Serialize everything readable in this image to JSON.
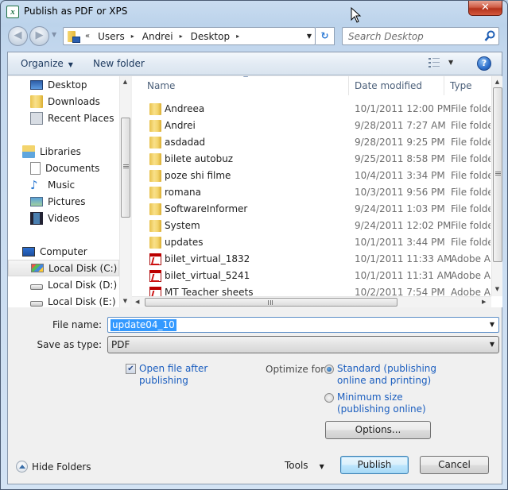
{
  "window": {
    "title": "Publish as PDF or XPS",
    "close_label": "✕"
  },
  "nav": {
    "back_label": "◀",
    "forward_label": "▶",
    "breadcrumb_prefix": "«",
    "breadcrumbs": [
      "Users",
      "Andrei",
      "Desktop"
    ],
    "crumb_arrow": "▸",
    "dropdown_arrow": "▼",
    "refresh_label": "↻",
    "search_placeholder": "Search Desktop"
  },
  "toolbar": {
    "organize_label": "Organize",
    "dropdown_arrow": "▼",
    "new_folder_label": "New folder",
    "help_label": "?"
  },
  "sidebar": {
    "items": [
      {
        "label": "Desktop",
        "icon": "desktop-icon",
        "level": 1
      },
      {
        "label": "Downloads",
        "icon": "downloads-icon",
        "level": 1
      },
      {
        "label": "Recent Places",
        "icon": "recent-places-icon",
        "level": 1
      },
      {
        "label": "Libraries",
        "icon": "libraries-icon",
        "level": 0
      },
      {
        "label": "Documents",
        "icon": "documents-icon",
        "level": 1
      },
      {
        "label": "Music",
        "icon": "music-icon",
        "level": 1
      },
      {
        "label": "Pictures",
        "icon": "pictures-icon",
        "level": 1
      },
      {
        "label": "Videos",
        "icon": "videos-icon",
        "level": 1
      },
      {
        "label": "Computer",
        "icon": "computer-icon",
        "level": 0
      },
      {
        "label": "Local Disk (C:)",
        "icon": "windows-drive-icon",
        "level": 1,
        "selected": true
      },
      {
        "label": "Local Disk (D:)",
        "icon": "drive-icon",
        "level": 1
      },
      {
        "label": "Local Disk (E:)",
        "icon": "drive-icon",
        "level": 1
      }
    ]
  },
  "filelist": {
    "columns": [
      "Name",
      "Date modified",
      "Type"
    ],
    "sort_indicator": "▲",
    "rows": [
      {
        "name": "Andreea",
        "date": "10/1/2011 12:00 PM",
        "type": "File folder",
        "kind": "folder"
      },
      {
        "name": "Andrei",
        "date": "9/28/2011 7:27 AM",
        "type": "File folder",
        "kind": "folder"
      },
      {
        "name": "asdadad",
        "date": "9/28/2011 9:25 PM",
        "type": "File folder",
        "kind": "folder"
      },
      {
        "name": "bilete autobuz",
        "date": "9/25/2011 8:58 PM",
        "type": "File folder",
        "kind": "folder"
      },
      {
        "name": "poze shi filme",
        "date": "10/4/2011 3:34 PM",
        "type": "File folder",
        "kind": "folder"
      },
      {
        "name": "romana",
        "date": "10/3/2011 9:56 PM",
        "type": "File folder",
        "kind": "folder"
      },
      {
        "name": "SoftwareInformer",
        "date": "9/24/2011 1:03 PM",
        "type": "File folder",
        "kind": "folder"
      },
      {
        "name": "System",
        "date": "9/24/2011 12:02 PM",
        "type": "File folder",
        "kind": "folder"
      },
      {
        "name": "updates",
        "date": "10/1/2011 3:44 PM",
        "type": "File folder",
        "kind": "folder"
      },
      {
        "name": "bilet_virtual_1832",
        "date": "10/1/2011 11:33 AM",
        "type": "Adobe Acrobat Document",
        "kind": "pdf"
      },
      {
        "name": "bilet_virtual_5241",
        "date": "10/1/2011 11:31 AM",
        "type": "Adobe Acrobat Document",
        "kind": "pdf"
      },
      {
        "name": "MT Teacher sheets",
        "date": "10/2/2011 7:54 PM",
        "type": "Adobe Acrobat Document",
        "kind": "pdf"
      }
    ]
  },
  "form": {
    "file_name_label": "File name:",
    "file_name_value": "update04_10",
    "save_as_type_label": "Save as type:",
    "save_as_type_value": "PDF",
    "open_after_label": "Open file after publishing",
    "open_after_line1": "Open file after",
    "open_after_line2": "publishing",
    "open_after_checked": true,
    "optimize_label": "Optimize for:",
    "optimize_options": [
      {
        "line1": "Standard (publishing",
        "line2": "online and printing)",
        "checked": true
      },
      {
        "line1": "Minimum size",
        "line2": "(publishing online)",
        "checked": false
      }
    ],
    "options_button": "Options...",
    "check_mark": "✔"
  },
  "footer": {
    "hide_folders_label": "Hide Folders",
    "tools_label": "Tools",
    "tools_arrow": "▼",
    "publish_label": "Publish",
    "cancel_label": "Cancel"
  }
}
